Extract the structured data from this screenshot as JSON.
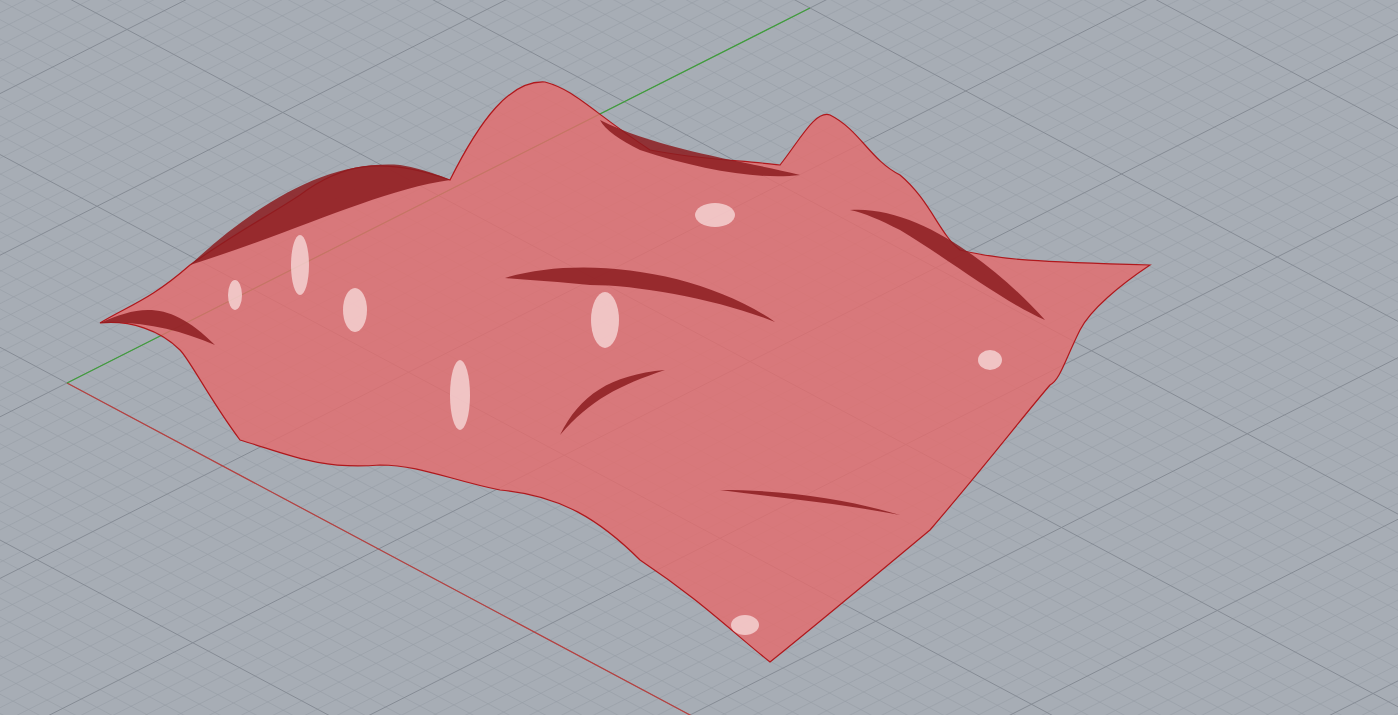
{
  "viewport": {
    "grid_visible": true,
    "axes_visible": true,
    "surface_selected": true
  }
}
